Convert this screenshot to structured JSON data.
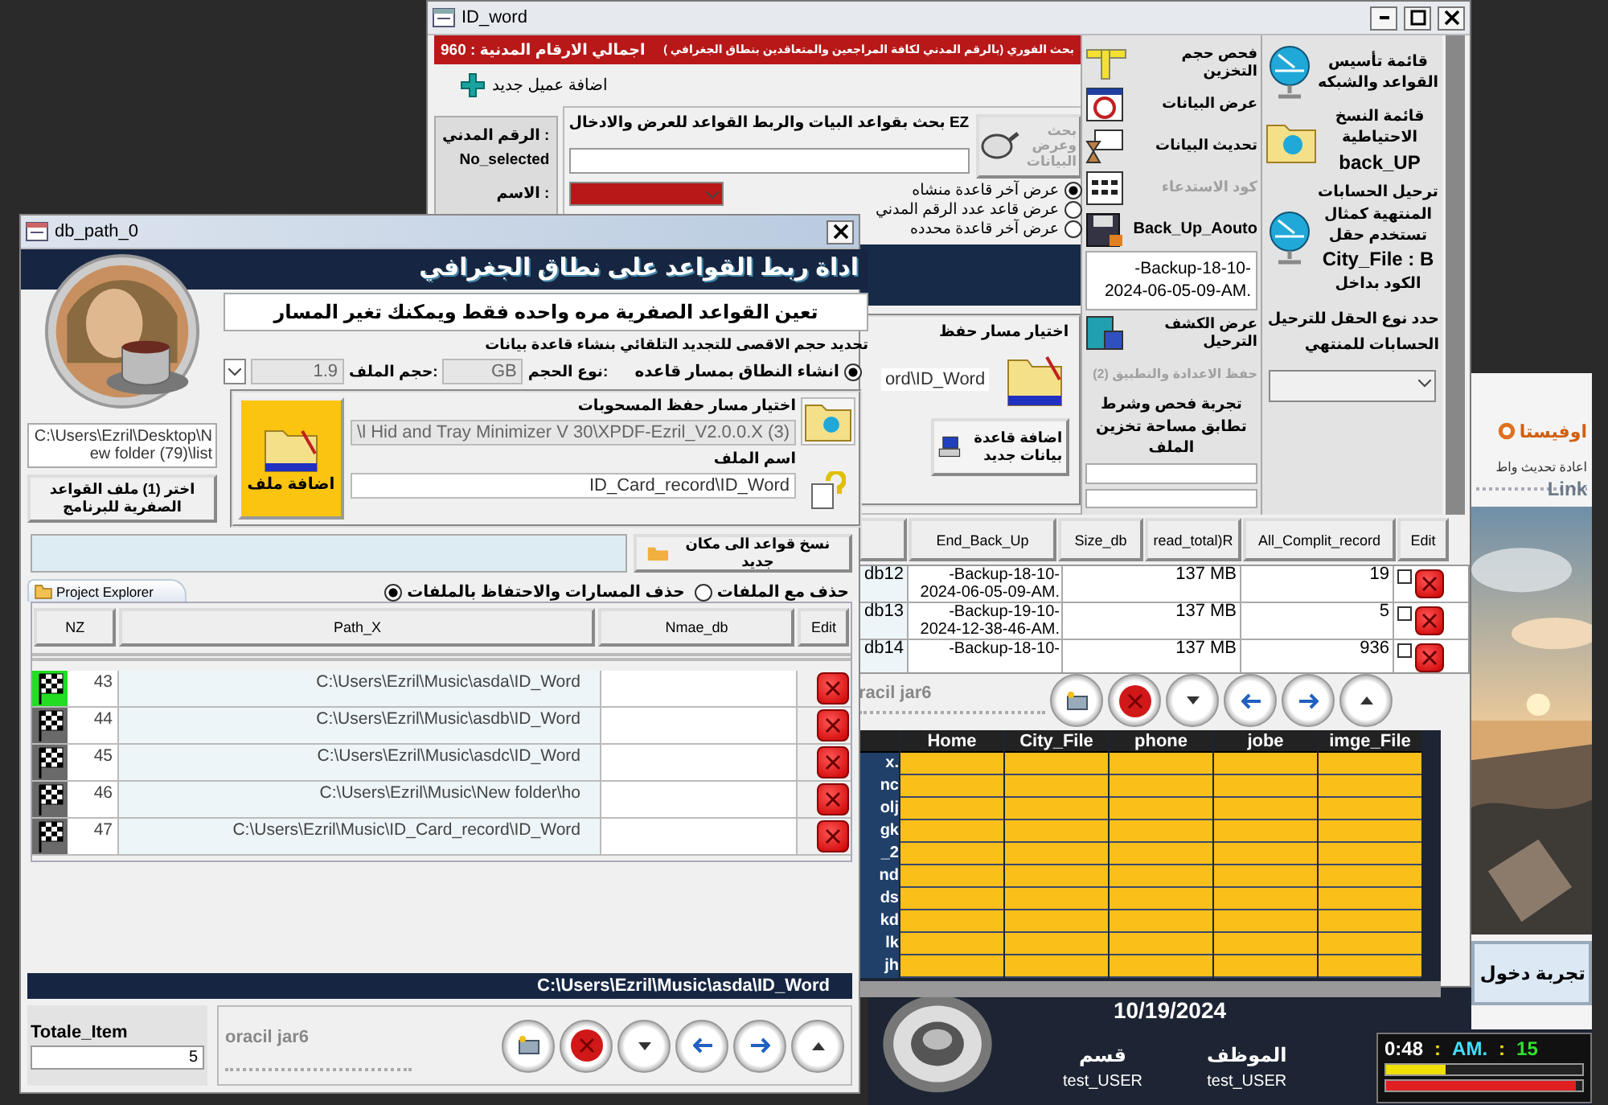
{
  "back": {
    "logo": "اوفيستا",
    "refresh_text": "اعادة تحديث واط",
    "link": "Link",
    "login_button": "تجربة دخول",
    "date": "10/19/2024",
    "dept_label": "قسم",
    "employee_label": "الموظف",
    "dept_value": "test_USER",
    "employee_value": "test_USER",
    "clock": [
      {
        "text": "15",
        "color": "#30e030"
      },
      {
        "text": ":",
        "color": "#f0e000"
      },
      {
        "text": "AM.",
        "color": "#40e0ff"
      },
      {
        "text": ":",
        "color": "#f0e000"
      },
      {
        "text": "0:48",
        "color": "#ffffff"
      }
    ],
    "meters": [
      {
        "level": 0.3,
        "color": "#f0e000"
      },
      {
        "level": 0.97,
        "color": "#e02020"
      }
    ]
  },
  "idw": {
    "title": "ID_word",
    "search_banner": "بحث الفوري (بالرقم المدني لكافة المراجعين والمتعاقدين بنطاق الجغرافي )",
    "total_label": "اجمالي الارقام المدنية : 960",
    "add_client": "اضافة عميل جديد",
    "civil_label": "الرقم المدني :",
    "civil_value": "No_selected",
    "name_label": "الاسم :",
    "search_title": "بحث بقواعد البيات والربط القواعد للعرض والادخال EZ",
    "search_button": {
      "label": "بحث وعرض البيانات",
      "disabled": true
    },
    "view_options": [
      {
        "label": "عرض آخر قاعدة منشاه",
        "selected": true
      },
      {
        "label": "عرض قاعد عدد الرقم المدني",
        "selected": false
      },
      {
        "label": "عرض آخر قاعدة محدده",
        "selected": false
      }
    ],
    "save_path_label": "اختيار مسار حفظ",
    "save_path_value": "ord\\ID_Word",
    "add_db_button": "اضافة قاعدة بيانات جديد",
    "tools": [
      {
        "kind": "ruler",
        "label": "فحص حجم التخزين",
        "disabled": false
      },
      {
        "kind": "clock",
        "label": "عرض البيانات",
        "disabled": false
      },
      {
        "kind": "hourglass",
        "label": "تحديث البيانات",
        "disabled": false
      },
      {
        "kind": "keypad",
        "label": "كود الاستدعاء",
        "disabled": true
      },
      {
        "kind": "floppy",
        "label": "Back_Up_Aouto",
        "disabled": false
      }
    ],
    "backup_value": "-Backup-18-10-2024-06-05-09-AM.",
    "report_button": "عرض الكشف الترحيل",
    "save_settings": {
      "label": "(2) حفظ الاعدادة والتطبيق",
      "disabled": true
    },
    "test_text": "تجربة فحص وشرط تطابق مساحة تخزين الملف",
    "menus": [
      {
        "kind": "globe",
        "label": "قائمة تأسيس القواعد والشبكه"
      },
      {
        "kind": "folder",
        "label": "قائمة النسخ الاحتياطية **back_UP**"
      },
      {
        "kind": "globe",
        "label": "ترحيل الحسابات المنتهية كمثال تستخدم حقل **City_File : B** الكود بداخل"
      }
    ],
    "field_type_label": "حدد نوع الحقل للترحيل الحسابات للمنتهي",
    "table": {
      "columns": [
        "Edit",
        "All_Complit_record",
        "read_total)R",
        "Size_db",
        "End_Back_Up"
      ],
      "rows": [
        {
          "name": "db12",
          "backup": "-Backup-18-10-2024-06-05-09-AM.",
          "size": "137 MB",
          "records": "19",
          "checked": false
        },
        {
          "name": "db13",
          "backup": "-Backup-19-10-2024-12-38-46-AM.",
          "size": "137 MB",
          "records": "5",
          "checked": false
        },
        {
          "name": "db14",
          "backup": "-Backup-18-10-",
          "size": "137 MB",
          "records": "936",
          "checked": false
        }
      ]
    },
    "footer_label": "racil jar6",
    "grid": {
      "columns": [
        "imge_File",
        "jobe",
        "phone",
        "City_File",
        "Home"
      ],
      "row_labels": [
        "x.",
        "nc",
        "olj",
        "gk",
        "_2",
        "nd",
        "ds",
        "kd",
        "lk",
        "jh"
      ]
    }
  },
  "dbp": {
    "title": "db_path_0",
    "header": "اداة ربط القواعد على نطاق الجغرافي",
    "subtitle": "تعين القواعد الصفرية مره واحده فقط ويمكنك تغير المسار",
    "limit_text": "تحديد حجم الاقصى للتجديد التلقائي بنشاء قاعدة بيانات",
    "create_option": {
      "label": "انشاء النطاق بمسار قاعده",
      "selected": true
    },
    "size_type_label": "نوع الحجم:",
    "size_type_value": "GB",
    "file_size_label": "حجم الملف:",
    "file_size_value": "1.9",
    "source_path": "C:\\Users\\Ezril\\Desktop\\New folder (79)\\list",
    "choose_button": "اختر (1) ملف القواعد الصفرية للبرنامج",
    "add_file_button": "اضافة ملف",
    "withdraw_label": "اختيار مسار حفظ المسحوبات",
    "withdraw_path": "l Hid and Tray Minimizer V 30\\XPDF-Ezril_V2.0.0.X (3)\\",
    "file_name_label": "اسم الملف",
    "file_name": "ID_Card_record\\ID_Word",
    "copy_button": "نسخ قواعد الى مكان جديد",
    "tab": "Project Explorer",
    "delete_options": [
      {
        "label": "حذف مع الملفات",
        "selected": false
      },
      {
        "label": "حذف المسارات والاحتفاظ بالملفات",
        "selected": true
      }
    ],
    "columns": [
      "Edit",
      "Nmae_db",
      "Path_X",
      "NZ"
    ],
    "rows": [
      {
        "nz": "43",
        "path": "C:\\Users\\Ezril\\Music\\asda\\ID_Word",
        "selected": true
      },
      {
        "nz": "44",
        "path": "C:\\Users\\Ezril\\Music\\asdb\\ID_Word",
        "selected": false
      },
      {
        "nz": "45",
        "path": "C:\\Users\\Ezril\\Music\\asdc\\ID_Word",
        "selected": false
      },
      {
        "nz": "46",
        "path": "C:\\Users\\Ezril\\Music\\New folder\\ho",
        "selected": false
      },
      {
        "nz": "47",
        "path": "C:\\Users\\Ezril\\Music\\ID_Card_record\\ID_Word",
        "selected": false
      }
    ],
    "status_path": "C:\\Users\\Ezril\\Music\\asda\\ID_Word",
    "total_label": "Totale_Item",
    "total_value": "5",
    "footer_label": "oracil jar6"
  }
}
